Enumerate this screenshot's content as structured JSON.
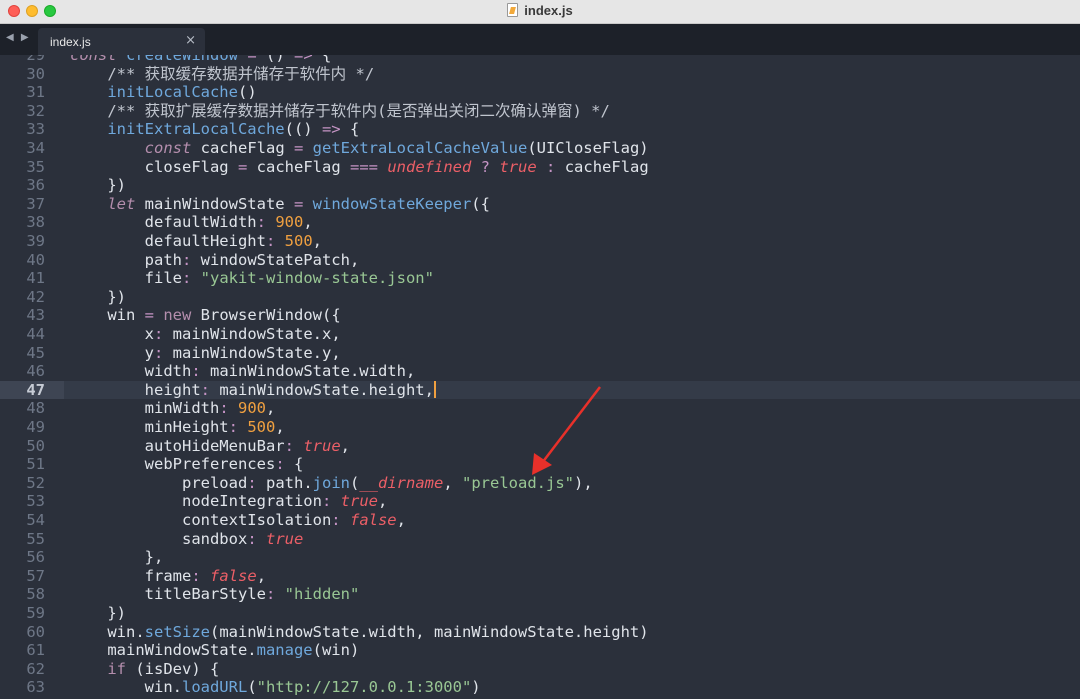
{
  "window": {
    "title": "index.js"
  },
  "tabs": [
    {
      "label": "index.js",
      "close": "×"
    }
  ],
  "nav": {
    "arrows": "◀ ▶"
  },
  "editor": {
    "active_line": 47,
    "lines": [
      {
        "n": "29",
        "tokens": [
          [
            "kw",
            "const"
          ],
          [
            "plain",
            " "
          ],
          [
            "fn",
            "createWindow"
          ],
          [
            "plain",
            " "
          ],
          [
            "op",
            "="
          ],
          [
            "plain",
            " () "
          ],
          [
            "op",
            "=>"
          ],
          [
            "plain",
            " {"
          ]
        ]
      },
      {
        "n": "30",
        "tokens": [
          [
            "plain",
            "    "
          ],
          [
            "cm",
            "/** 获取缓存数据并储存于软件内 */"
          ]
        ]
      },
      {
        "n": "31",
        "tokens": [
          [
            "plain",
            "    "
          ],
          [
            "fn",
            "initLocalCache"
          ],
          [
            "plain",
            "()"
          ]
        ]
      },
      {
        "n": "32",
        "tokens": [
          [
            "plain",
            "    "
          ],
          [
            "cm",
            "/** 获取扩展缓存数据并储存于软件内(是否弹出关闭二次确认弹窗) */"
          ]
        ]
      },
      {
        "n": "33",
        "tokens": [
          [
            "plain",
            "    "
          ],
          [
            "fn",
            "initExtraLocalCache"
          ],
          [
            "plain",
            "(() "
          ],
          [
            "op",
            "=>"
          ],
          [
            "plain",
            " {"
          ]
        ]
      },
      {
        "n": "34",
        "tokens": [
          [
            "plain",
            "        "
          ],
          [
            "kw",
            "const"
          ],
          [
            "plain",
            " cacheFlag "
          ],
          [
            "op",
            "="
          ],
          [
            "plain",
            " "
          ],
          [
            "fn",
            "getExtraLocalCacheValue"
          ],
          [
            "plain",
            "(UICloseFlag)"
          ]
        ]
      },
      {
        "n": "35",
        "tokens": [
          [
            "plain",
            "        closeFlag "
          ],
          [
            "op",
            "="
          ],
          [
            "plain",
            " cacheFlag "
          ],
          [
            "op",
            "==="
          ],
          [
            "plain",
            " "
          ],
          [
            "bool",
            "undefined"
          ],
          [
            "plain",
            " "
          ],
          [
            "op",
            "?"
          ],
          [
            "plain",
            " "
          ],
          [
            "bool",
            "true"
          ],
          [
            "plain",
            " "
          ],
          [
            "op",
            ":"
          ],
          [
            "plain",
            " cacheFlag"
          ]
        ]
      },
      {
        "n": "36",
        "tokens": [
          [
            "plain",
            "    })"
          ]
        ]
      },
      {
        "n": "37",
        "tokens": [
          [
            "plain",
            "    "
          ],
          [
            "kw",
            "let"
          ],
          [
            "plain",
            " mainWindowState "
          ],
          [
            "op",
            "="
          ],
          [
            "plain",
            " "
          ],
          [
            "fn",
            "windowStateKeeper"
          ],
          [
            "plain",
            "({"
          ]
        ]
      },
      {
        "n": "38",
        "tokens": [
          [
            "plain",
            "        defaultWidth"
          ],
          [
            "op",
            ":"
          ],
          [
            "plain",
            " "
          ],
          [
            "num",
            "900"
          ],
          [
            "plain",
            ","
          ]
        ]
      },
      {
        "n": "39",
        "tokens": [
          [
            "plain",
            "        defaultHeight"
          ],
          [
            "op",
            ":"
          ],
          [
            "plain",
            " "
          ],
          [
            "num",
            "500"
          ],
          [
            "plain",
            ","
          ]
        ]
      },
      {
        "n": "40",
        "tokens": [
          [
            "plain",
            "        path"
          ],
          [
            "op",
            ":"
          ],
          [
            "plain",
            " windowStatePatch,"
          ]
        ]
      },
      {
        "n": "41",
        "tokens": [
          [
            "plain",
            "        file"
          ],
          [
            "op",
            ":"
          ],
          [
            "plain",
            " "
          ],
          [
            "str",
            "\"yakit-window-state.json\""
          ]
        ]
      },
      {
        "n": "42",
        "tokens": [
          [
            "plain",
            "    })"
          ]
        ]
      },
      {
        "n": "43",
        "tokens": [
          [
            "plain",
            "    win "
          ],
          [
            "op",
            "="
          ],
          [
            "plain",
            " "
          ],
          [
            "kw2",
            "new"
          ],
          [
            "plain",
            " BrowserWindow({"
          ]
        ]
      },
      {
        "n": "44",
        "tokens": [
          [
            "plain",
            "        x"
          ],
          [
            "op",
            ":"
          ],
          [
            "plain",
            " mainWindowState.x,"
          ]
        ]
      },
      {
        "n": "45",
        "tokens": [
          [
            "plain",
            "        y"
          ],
          [
            "op",
            ":"
          ],
          [
            "plain",
            " mainWindowState.y,"
          ]
        ]
      },
      {
        "n": "46",
        "tokens": [
          [
            "plain",
            "        width"
          ],
          [
            "op",
            ":"
          ],
          [
            "plain",
            " mainWindowState.width,"
          ]
        ]
      },
      {
        "n": "47",
        "tokens": [
          [
            "plain",
            "        height"
          ],
          [
            "op",
            ":"
          ],
          [
            "plain",
            " mainWindowState.height,"
          ]
        ]
      },
      {
        "n": "48",
        "tokens": [
          [
            "plain",
            "        minWidth"
          ],
          [
            "op",
            ":"
          ],
          [
            "plain",
            " "
          ],
          [
            "num",
            "900"
          ],
          [
            "plain",
            ","
          ]
        ]
      },
      {
        "n": "49",
        "tokens": [
          [
            "plain",
            "        minHeight"
          ],
          [
            "op",
            ":"
          ],
          [
            "plain",
            " "
          ],
          [
            "num",
            "500"
          ],
          [
            "plain",
            ","
          ]
        ]
      },
      {
        "n": "50",
        "tokens": [
          [
            "plain",
            "        autoHideMenuBar"
          ],
          [
            "op",
            ":"
          ],
          [
            "plain",
            " "
          ],
          [
            "bool",
            "true"
          ],
          [
            "plain",
            ","
          ]
        ]
      },
      {
        "n": "51",
        "tokens": [
          [
            "plain",
            "        webPreferences"
          ],
          [
            "op",
            ":"
          ],
          [
            "plain",
            " {"
          ]
        ]
      },
      {
        "n": "52",
        "tokens": [
          [
            "plain",
            "            preload"
          ],
          [
            "op",
            ":"
          ],
          [
            "plain",
            " path."
          ],
          [
            "fn",
            "join"
          ],
          [
            "plain",
            "("
          ],
          [
            "bool",
            "__dirname"
          ],
          [
            "plain",
            ", "
          ],
          [
            "str",
            "\"preload.js\""
          ],
          [
            "plain",
            "),"
          ]
        ]
      },
      {
        "n": "53",
        "tokens": [
          [
            "plain",
            "            nodeIntegration"
          ],
          [
            "op",
            ":"
          ],
          [
            "plain",
            " "
          ],
          [
            "bool",
            "true"
          ],
          [
            "plain",
            ","
          ]
        ]
      },
      {
        "n": "54",
        "tokens": [
          [
            "plain",
            "            contextIsolation"
          ],
          [
            "op",
            ":"
          ],
          [
            "plain",
            " "
          ],
          [
            "bool",
            "false"
          ],
          [
            "plain",
            ","
          ]
        ]
      },
      {
        "n": "55",
        "tokens": [
          [
            "plain",
            "            sandbox"
          ],
          [
            "op",
            ":"
          ],
          [
            "plain",
            " "
          ],
          [
            "bool",
            "true"
          ]
        ]
      },
      {
        "n": "56",
        "tokens": [
          [
            "plain",
            "        },"
          ]
        ]
      },
      {
        "n": "57",
        "tokens": [
          [
            "plain",
            "        frame"
          ],
          [
            "op",
            ":"
          ],
          [
            "plain",
            " "
          ],
          [
            "bool",
            "false"
          ],
          [
            "plain",
            ","
          ]
        ]
      },
      {
        "n": "58",
        "tokens": [
          [
            "plain",
            "        titleBarStyle"
          ],
          [
            "op",
            ":"
          ],
          [
            "plain",
            " "
          ],
          [
            "str",
            "\"hidden\""
          ]
        ]
      },
      {
        "n": "59",
        "tokens": [
          [
            "plain",
            "    })"
          ]
        ]
      },
      {
        "n": "60",
        "tokens": [
          [
            "plain",
            "    win."
          ],
          [
            "fn",
            "setSize"
          ],
          [
            "plain",
            "(mainWindowState.width, mainWindowState.height)"
          ]
        ]
      },
      {
        "n": "61",
        "tokens": [
          [
            "plain",
            "    mainWindowState."
          ],
          [
            "fn",
            "manage"
          ],
          [
            "plain",
            "(win)"
          ]
        ]
      },
      {
        "n": "62",
        "tokens": [
          [
            "plain",
            "    "
          ],
          [
            "kw2",
            "if"
          ],
          [
            "plain",
            " (isDev) {"
          ]
        ]
      },
      {
        "n": "63",
        "tokens": [
          [
            "plain",
            "        win."
          ],
          [
            "fn",
            "loadURL"
          ],
          [
            "plain",
            "("
          ],
          [
            "str",
            "\"http://127.0.0.1:3000\""
          ],
          [
            "plain",
            ")"
          ]
        ]
      }
    ]
  },
  "colors": {
    "arrow": "#e8302a",
    "caret": "#f0a040"
  }
}
